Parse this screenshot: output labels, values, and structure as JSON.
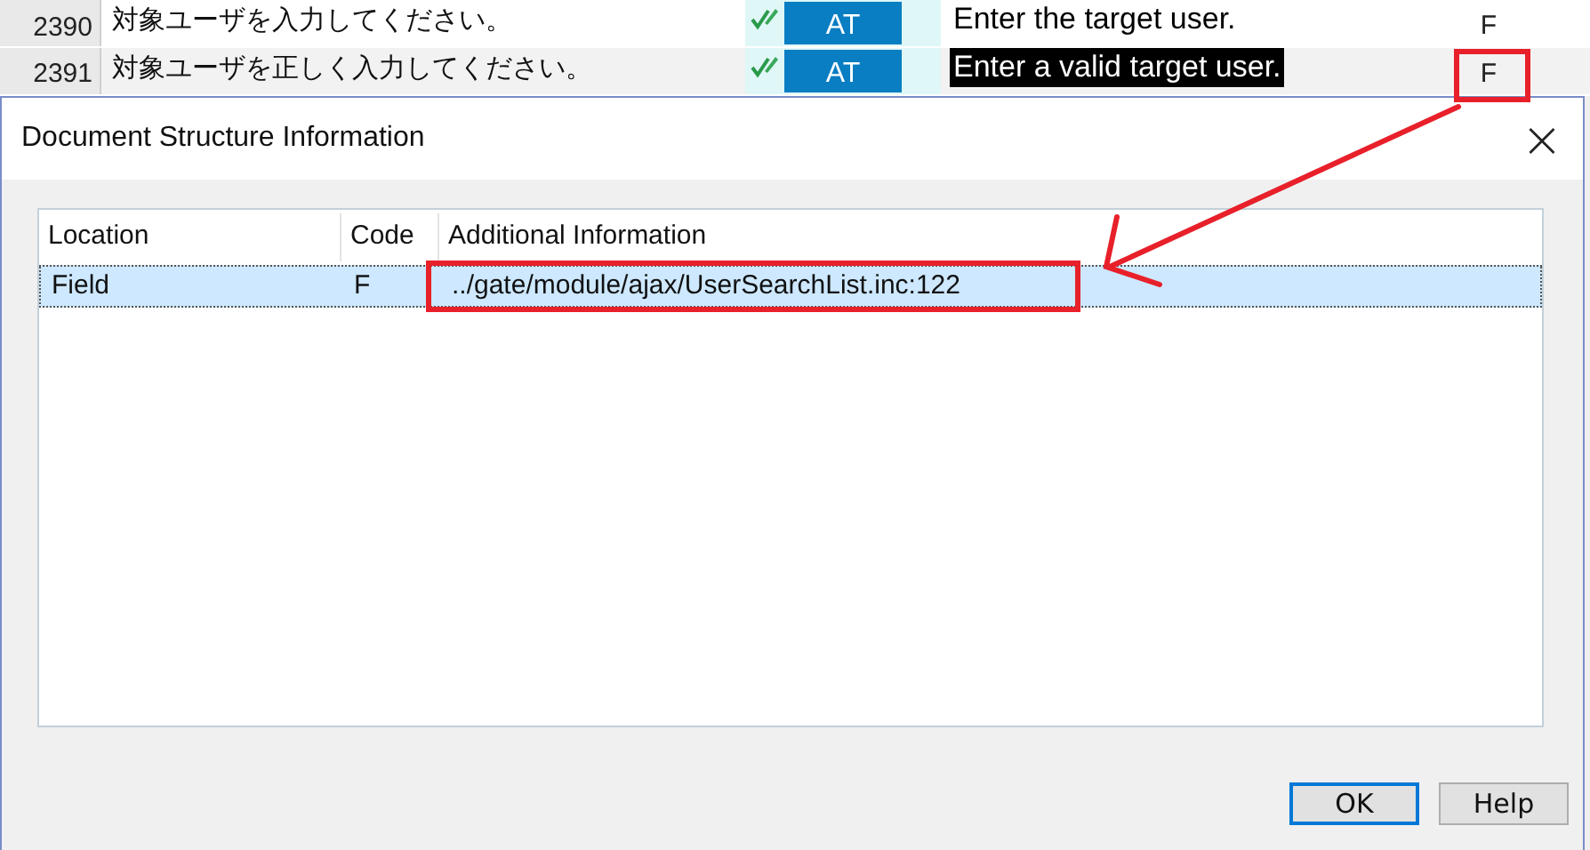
{
  "grid": {
    "rows": [
      {
        "number": "2390",
        "source": "対象ユーザを入力してください。",
        "tag": "AT",
        "target": "Enter the target user.",
        "code": "F",
        "selected": false
      },
      {
        "number": "2391",
        "source": "対象ユーザを正しく入力してください。",
        "tag": "AT",
        "target": "Enter a valid target user.",
        "code": "F",
        "selected": true
      }
    ]
  },
  "dialog": {
    "title": "Document Structure Information",
    "close": "×",
    "table": {
      "columns": [
        "Location",
        "Code",
        "Additional Information"
      ],
      "rows": [
        {
          "cells": [
            "Field",
            "F",
            "../gate/module/ajax/UserSearchList.inc:122"
          ],
          "selected": true
        }
      ]
    },
    "buttons": [
      {
        "label": "OK",
        "default": true
      },
      {
        "label": "Help",
        "default": false
      }
    ]
  }
}
